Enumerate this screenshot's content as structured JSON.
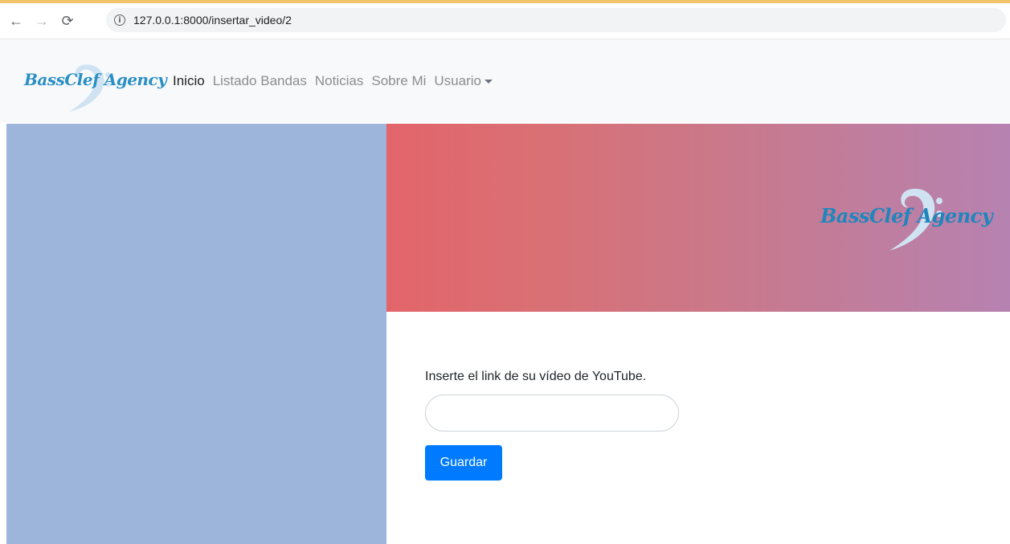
{
  "browser": {
    "back_icon": "arrow-left-icon",
    "forward_icon": "arrow-right-icon",
    "reload_icon": "reload-icon",
    "info_icon": "info-icon",
    "url": "127.0.0.1:8000/insertar_video/2",
    "accent_top_color": "#f0c46a"
  },
  "navbar": {
    "brand": "BassClef Agency",
    "links": [
      "Inicio",
      "Listado Bandas",
      "Noticias",
      "Sobre Mi"
    ],
    "active_link": "Inicio",
    "user_menu": "Usuario",
    "background": "#f8f9fa"
  },
  "hero": {
    "brand": "BassClef Agency",
    "gradient_start": "#e3656a",
    "gradient_end": "#b682b1"
  },
  "left_panel": {
    "background": "#9db5da"
  },
  "form": {
    "label": "Inserte el link de su vídeo de YouTube.",
    "input_value": "",
    "submit_label": "Guardar",
    "submit_color": "#007bff"
  }
}
